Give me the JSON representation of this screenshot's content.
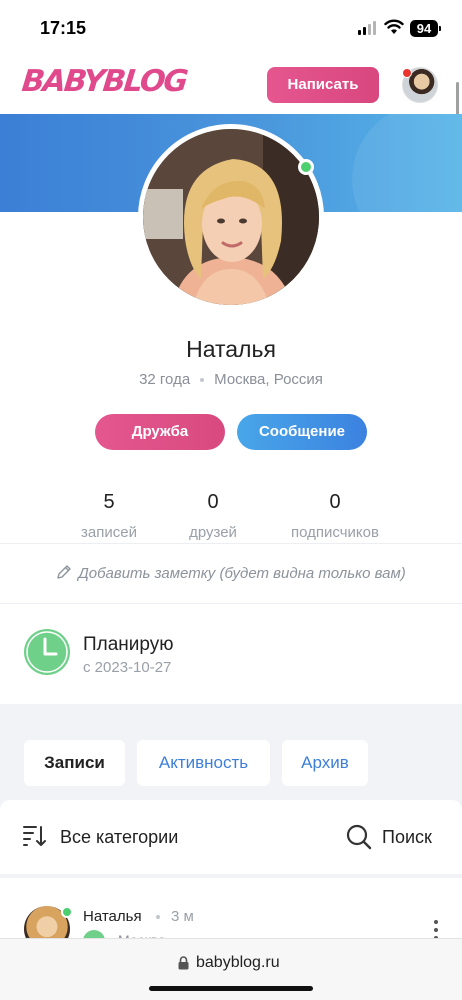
{
  "status_bar": {
    "time": "17:15",
    "battery": "94"
  },
  "header": {
    "logo": "BABYBLOG",
    "write_button": "Написать"
  },
  "profile": {
    "name": "Наталья",
    "age": "32 года",
    "location": "Москва, Россия",
    "friend_button": "Дружба",
    "message_button": "Сообщение",
    "stats": [
      {
        "value": "5",
        "label": "записей"
      },
      {
        "value": "0",
        "label": "друзей"
      },
      {
        "value": "0",
        "label": "подписчиков"
      }
    ],
    "add_note": "Добавить заметку (будет видна только вам)",
    "status_title": "Планирую",
    "status_date": "с 2023-10-27"
  },
  "tabs": [
    {
      "label": "Записи",
      "active": true
    },
    {
      "label": "Активность",
      "active": false
    },
    {
      "label": "Архив",
      "active": false
    }
  ],
  "filter": {
    "categories": "Все категории",
    "search": "Поиск"
  },
  "post": {
    "author": "Наталья",
    "time": "3 м",
    "location": "Москва"
  },
  "browser": {
    "url": "babyblog.ru"
  },
  "colors": {
    "brand_pink": "#e04a8c",
    "link_blue": "#3d7fd9",
    "online_green": "#4ccf6f"
  }
}
